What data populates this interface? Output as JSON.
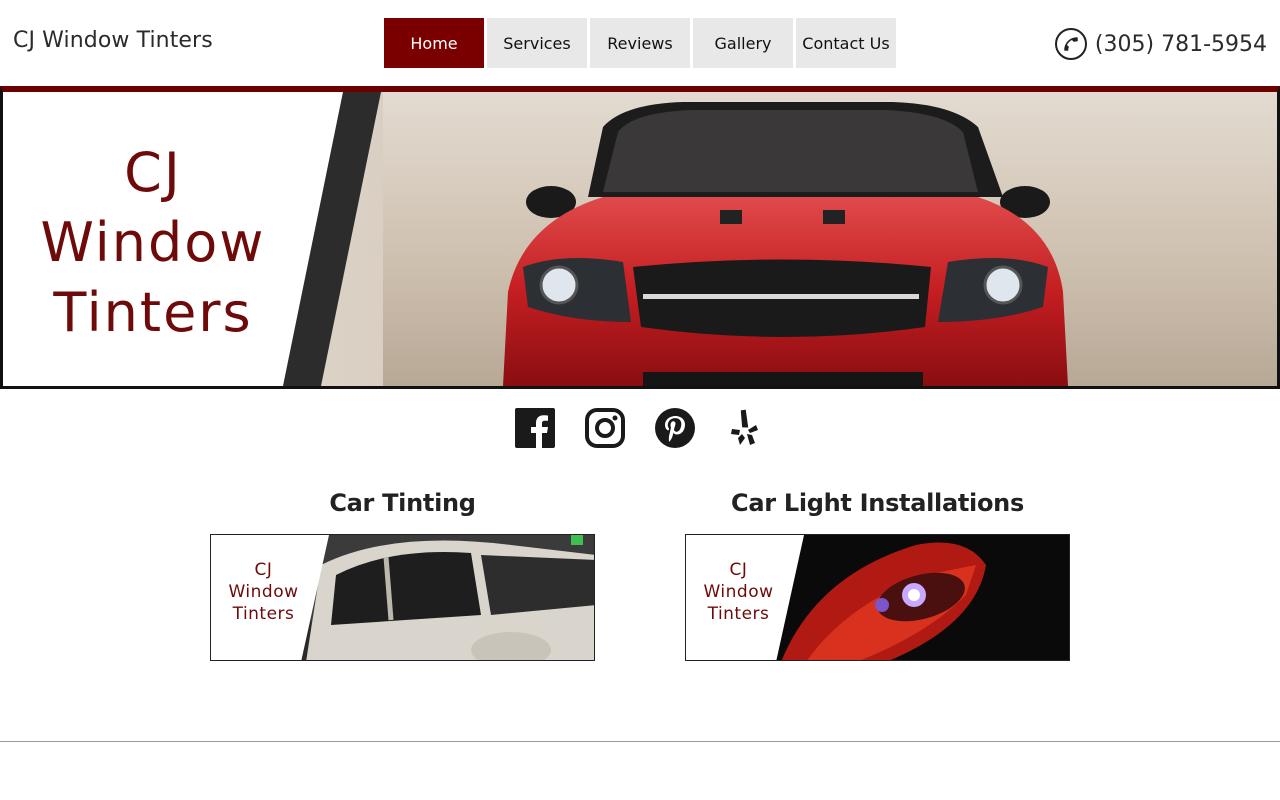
{
  "header": {
    "site_title": "CJ Window Tinters",
    "phone": "(305) 781-5954",
    "phone_icon": "phone-icon"
  },
  "nav": {
    "items": [
      {
        "label": "Home",
        "active": true
      },
      {
        "label": "Services",
        "active": false
      },
      {
        "label": "Reviews",
        "active": false
      },
      {
        "label": "Gallery",
        "active": false
      },
      {
        "label": "Contact Us",
        "active": false
      }
    ]
  },
  "hero": {
    "logo_lines": [
      "CJ",
      "Window",
      "Tinters"
    ]
  },
  "social": {
    "icons": [
      "facebook-icon",
      "instagram-icon",
      "pinterest-icon",
      "yelp-icon"
    ]
  },
  "services": [
    {
      "title": "Car Tinting",
      "logo_lines": [
        "CJ",
        "Window",
        "Tinters"
      ]
    },
    {
      "title": "Car Light Installations",
      "logo_lines": [
        "CJ",
        "Window",
        "Tinters"
      ]
    }
  ],
  "colors": {
    "accent": "#7a0000",
    "nav_bg": "#e8e8e8",
    "logo_text": "#6e0a0a"
  }
}
